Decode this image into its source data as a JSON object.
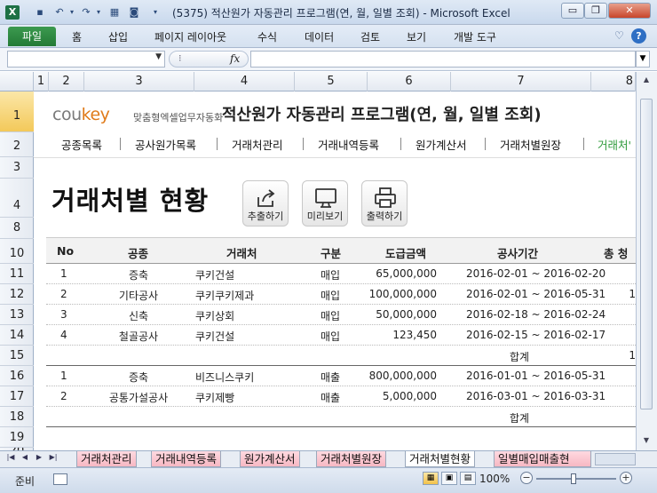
{
  "window": {
    "title": "(5375) 적산원가 자동관리 프로그램(연, 월, 일별 조회)  -  Microsoft Excel",
    "app_icon": "X",
    "buttons": {
      "minimize": "▭",
      "restore": "❐",
      "close": "✕"
    }
  },
  "ribbon": {
    "file": "파일",
    "tabs": [
      "홈",
      "삽입",
      "페이지 레이아웃",
      "수식",
      "데이터",
      "검토",
      "보기",
      "개발 도구"
    ],
    "help": "?"
  },
  "formula_bar": {
    "name_box": "",
    "fx": "fx",
    "formula": ""
  },
  "columns": [
    "1",
    "2",
    "3",
    "4",
    "5",
    "6",
    "7",
    "8"
  ],
  "rows": [
    "1",
    "2",
    "3",
    "4",
    "8",
    "10",
    "11",
    "12",
    "13",
    "14",
    "15",
    "16",
    "17",
    "18",
    "19",
    "20"
  ],
  "sheet": {
    "logo_main": "cou",
    "logo_key": "key",
    "logo_sub": "맞춤형엑셀업무자동화",
    "program_title": "적산원가 자동관리 프로그램(연, 월, 일별 조회)",
    "nav": [
      "공종목록",
      "공사원가목록",
      "거래처관리",
      "거래내역등록",
      "원가계산서",
      "거래처별원장",
      "거래처'"
    ],
    "page_title": "거래처별 현황",
    "actions": [
      {
        "label": "추출하기",
        "icon": "export-icon"
      },
      {
        "label": "미리보기",
        "icon": "monitor-icon"
      },
      {
        "label": "출력하기",
        "icon": "printer-icon"
      }
    ],
    "table_headers": [
      "No",
      "공종",
      "거래처",
      "구분",
      "도급금액",
      "공사기간",
      "총 청"
    ],
    "rows": [
      {
        "no": "1",
        "type": "증축",
        "vendor": "쿠키건설",
        "kind": "매입",
        "amount": "65,000,000",
        "period": "2016-02-01 ~ 2016-02-20",
        "extra": ""
      },
      {
        "no": "2",
        "type": "기타공사",
        "vendor": "쿠키쿠키제과",
        "kind": "매입",
        "amount": "100,000,000",
        "period": "2016-02-01 ~ 2016-05-31",
        "extra": "1"
      },
      {
        "no": "3",
        "type": "신축",
        "vendor": "쿠키상회",
        "kind": "매입",
        "amount": "50,000,000",
        "period": "2016-02-18 ~ 2016-02-24",
        "extra": ""
      },
      {
        "no": "4",
        "type": "철골공사",
        "vendor": "쿠키건설",
        "kind": "매입",
        "amount": "123,450",
        "period": "2016-02-15 ~ 2016-02-17",
        "extra": ""
      },
      {
        "no": "",
        "type": "",
        "vendor": "",
        "kind": "",
        "amount": "",
        "period": "합계",
        "extra": "1"
      },
      {
        "no": "1",
        "type": "증축",
        "vendor": "비즈니스쿠키",
        "kind": "매출",
        "amount": "800,000,000",
        "period": "2016-01-01 ~ 2016-05-31",
        "extra": ""
      },
      {
        "no": "2",
        "type": "공통가설공사",
        "vendor": "쿠키제빵",
        "kind": "매출",
        "amount": "5,000,000",
        "period": "2016-03-01 ~ 2016-03-31",
        "extra": ""
      },
      {
        "no": "",
        "type": "",
        "vendor": "",
        "kind": "",
        "amount": "",
        "period": "합계",
        "extra": ""
      }
    ]
  },
  "sheet_tabs": [
    "거래처관리",
    "거래내역등록",
    "원가계산서",
    "거래처별원장",
    "거래처별현황",
    "일별매입매출현"
  ],
  "status": {
    "ready": "준비",
    "zoom": "100%"
  }
}
